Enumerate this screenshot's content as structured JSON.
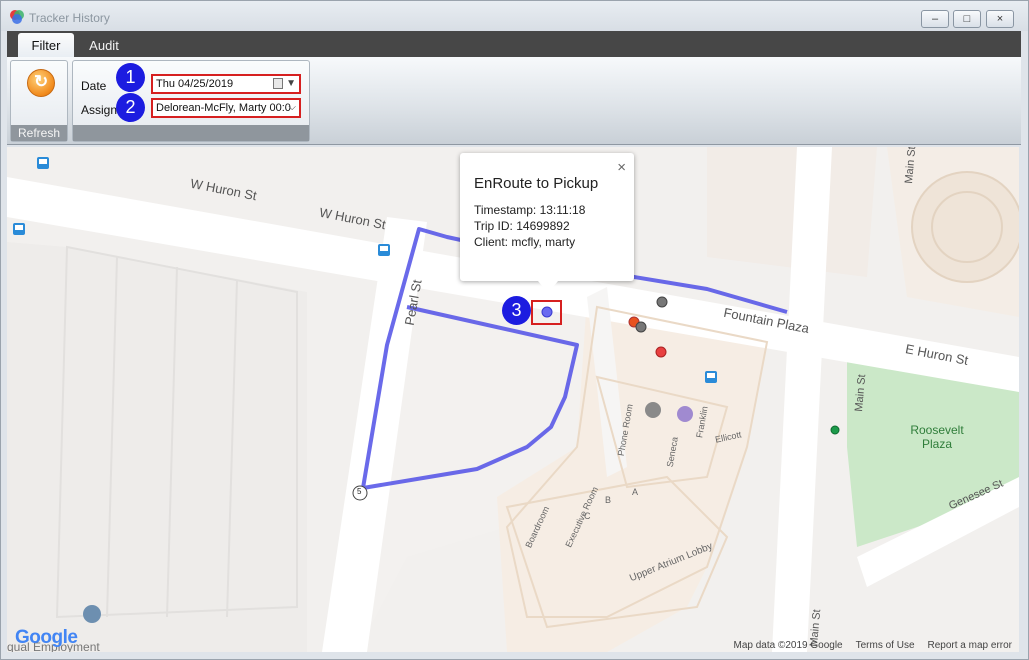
{
  "window": {
    "title": "Tracker History",
    "controls": [
      "–",
      "□",
      "×"
    ]
  },
  "tabs": [
    {
      "label": "Filter",
      "active": true
    },
    {
      "label": "Audit",
      "active": false
    }
  ],
  "ribbon": {
    "refresh_label": "Refresh",
    "date_label": "Date",
    "date_value": "Thu  04/25/2019",
    "assign_label": "Assign",
    "assign_value": "Delorean-McFly, Marty 00:0"
  },
  "annotations": [
    "1",
    "2",
    "3"
  ],
  "popup": {
    "title": "EnRoute to Pickup",
    "timestamp": "Timestamp: 13:11:18",
    "trip": "Trip ID: 14699892",
    "client": "Client: mcfly, marty",
    "close": "×"
  },
  "map": {
    "streets": {
      "w_huron_1": "W Huron St",
      "w_huron_2": "W Huron St",
      "pearl": "Pearl St",
      "fountain": "Fountain Plaza",
      "e_huron": "E Huron St",
      "main_1": "Main St",
      "main_2": "Main St",
      "main_3": "Main St",
      "genesee": "Genesee St"
    },
    "places": {
      "roosevelt": "Roosevelt Plaza",
      "phone_room": "Phone Room",
      "seneca": "Seneca",
      "franklin": "Franklin",
      "ellicott": "Ellicott",
      "exec_room": "Executive Room",
      "boardroom": "Boardroom",
      "a": "A",
      "b": "B",
      "c": "C",
      "upper_atrium": "Upper Atrium Lobby",
      "route_5": "5"
    },
    "google_logo": "Google",
    "bottom_text": "qual Employment",
    "footer": [
      "Map data ©2019 Google",
      "Terms of Use",
      "Report a map error"
    ]
  },
  "colors": {
    "route": "#5050e6",
    "badge": "#1c1ce0",
    "highlight": "#d62020",
    "park": "#cbe8c8"
  }
}
